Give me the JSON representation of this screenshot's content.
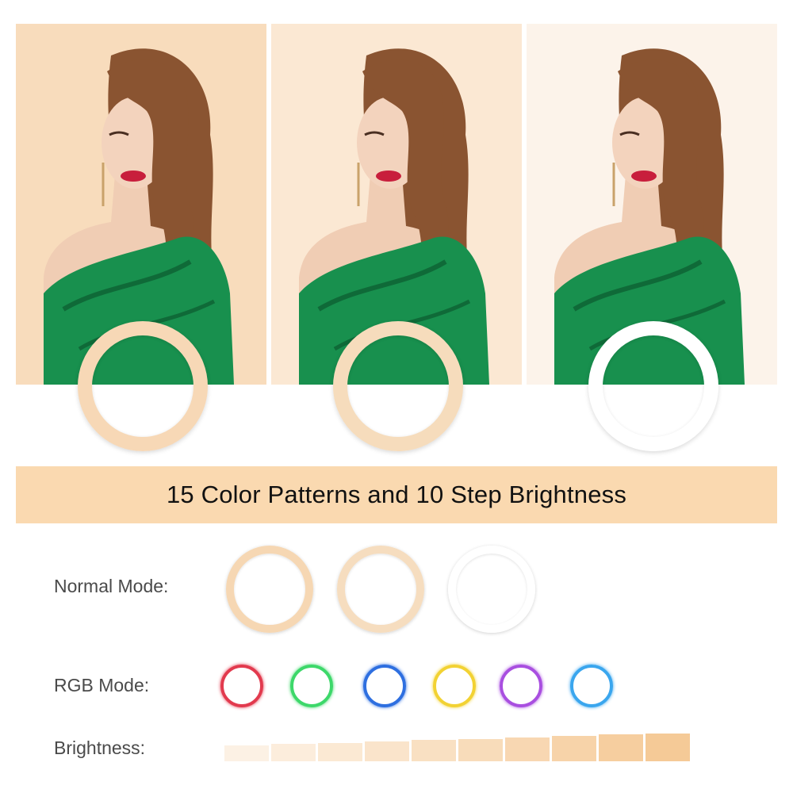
{
  "banner": {
    "text": "15 Color Patterns and 10 Step Brightness"
  },
  "photos": [
    {
      "background": "#f8dcbc",
      "tone": "warm"
    },
    {
      "background": "#fbe8d3",
      "tone": "neutral"
    },
    {
      "background": "#fcf3ea",
      "tone": "cool"
    }
  ],
  "big_rings": [
    "#f7d8b6",
    "#f6dcbc",
    "#ffffff"
  ],
  "labels": {
    "normal_mode": "Normal Mode:",
    "rgb_mode": "RGB Mode:",
    "brightness": "Brightness:"
  },
  "normal_rings": [
    "#f6d7b3",
    "#f6ddbf",
    "#ffffff"
  ],
  "rgb_rings": [
    "#e23a4e",
    "#3dd86a",
    "#2e6fe0",
    "#f2d233",
    "#a94fe0",
    "#3aa6ee"
  ],
  "brightness_steps": [
    1,
    2,
    3,
    4,
    5,
    6,
    7,
    8,
    9,
    10
  ],
  "colors": {
    "banner": "#fad9b0",
    "dress": "#18904e",
    "hair": "#8a5431"
  }
}
